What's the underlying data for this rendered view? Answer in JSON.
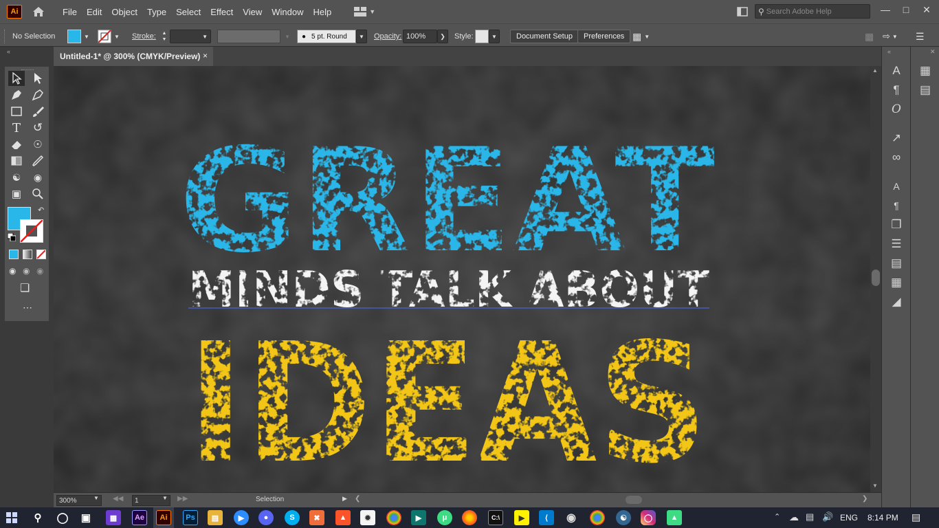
{
  "app": {
    "logo": "Ai"
  },
  "menu": {
    "items": [
      "File",
      "Edit",
      "Object",
      "Type",
      "Select",
      "Effect",
      "View",
      "Window",
      "Help"
    ],
    "search_placeholder": "Search Adobe Help"
  },
  "control_bar": {
    "selection_label": "No Selection",
    "fill_color": "#29b6e8",
    "stroke_label": "Stroke:",
    "brush_label": "5 pt. Round",
    "opacity_label": "Opacity:",
    "opacity_value": "100%",
    "style_label": "Style:",
    "document_setup_label": "Document Setup",
    "preferences_label": "Preferences"
  },
  "document": {
    "tab_title": "Untitled-1* @ 300% (CMYK/Preview)",
    "close_glyph": "×"
  },
  "artwork": {
    "line1": "GREAT",
    "line2": "MINDS TALK ABOUT",
    "line3": "IDEAS",
    "line1_color": "#29b6e8",
    "line2_color": "#f4f4f4",
    "line3_color": "#f2c512",
    "background_color": "#2f2f2f"
  },
  "status_bar": {
    "zoom": "300%",
    "artboard": "1",
    "tool": "Selection"
  },
  "taskbar": {
    "language": "ENG",
    "time": "8:14 PM"
  },
  "icons": {
    "home": "home-icon",
    "search": "search-icon",
    "workspace": "workspace-switcher-icon",
    "minimize": "minimize-icon",
    "maximize": "maximize-icon",
    "close": "close-icon"
  }
}
